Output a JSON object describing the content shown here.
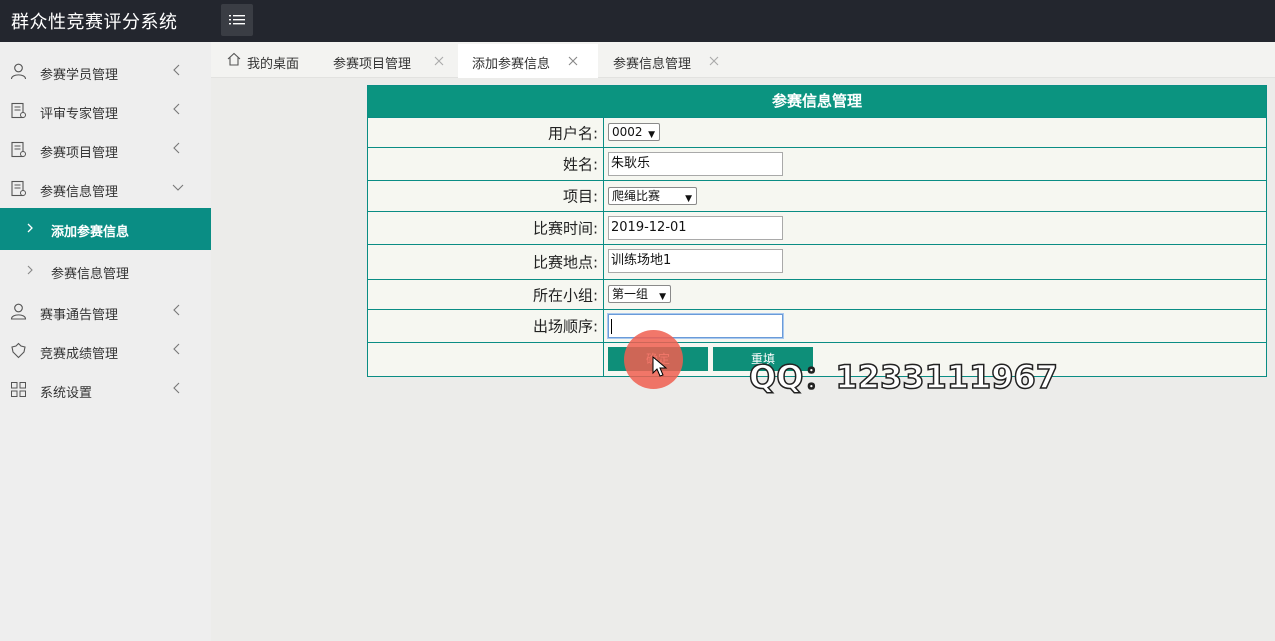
{
  "app": {
    "title": "群众性竞赛评分系统"
  },
  "topbar": {
    "menu_icon": "list-icon"
  },
  "sidebar": {
    "items": [
      {
        "label": "参赛学员管理",
        "icon": "user-icon",
        "expanded": false
      },
      {
        "label": "评审专家管理",
        "icon": "document-icon",
        "expanded": false
      },
      {
        "label": "参赛项目管理",
        "icon": "document-icon",
        "expanded": false
      },
      {
        "label": "参赛信息管理",
        "icon": "document-icon",
        "expanded": true
      },
      {
        "label": "赛事通告管理",
        "icon": "user-icon",
        "expanded": false
      },
      {
        "label": "竞赛成绩管理",
        "icon": "trophy-icon",
        "expanded": false
      },
      {
        "label": "系统设置",
        "icon": "grid-icon",
        "expanded": false
      }
    ],
    "subitems": [
      {
        "label": "添加参赛信息",
        "active": true
      },
      {
        "label": "参赛信息管理",
        "active": false
      }
    ]
  },
  "tabs": [
    {
      "label": "我的桌面",
      "closable": false,
      "active": false
    },
    {
      "label": "参赛项目管理",
      "closable": true,
      "active": false
    },
    {
      "label": "添加参赛信息",
      "closable": true,
      "active": true
    },
    {
      "label": "参赛信息管理",
      "closable": true,
      "active": false
    }
  ],
  "form": {
    "title": "参赛信息管理",
    "fields": {
      "username": {
        "label": "用户名:",
        "value": "0002"
      },
      "name": {
        "label": "姓名:",
        "value": "朱耿乐"
      },
      "project": {
        "label": "项目:",
        "value": "爬绳比赛"
      },
      "match_time": {
        "label": "比赛时间:",
        "value": "2019-12-01"
      },
      "match_location": {
        "label": "比赛地点:",
        "value": "训练场地1"
      },
      "group": {
        "label": "所在小组:",
        "value": "第一组"
      },
      "order": {
        "label": "出场顺序:",
        "value": ""
      }
    },
    "buttons": {
      "submit": "确定",
      "reset": "重填"
    }
  },
  "watermark": "QQ：1233111967",
  "colors": {
    "accent": "#0a8d84",
    "topbar": "#23262e",
    "click_highlight": "#f05f50"
  }
}
